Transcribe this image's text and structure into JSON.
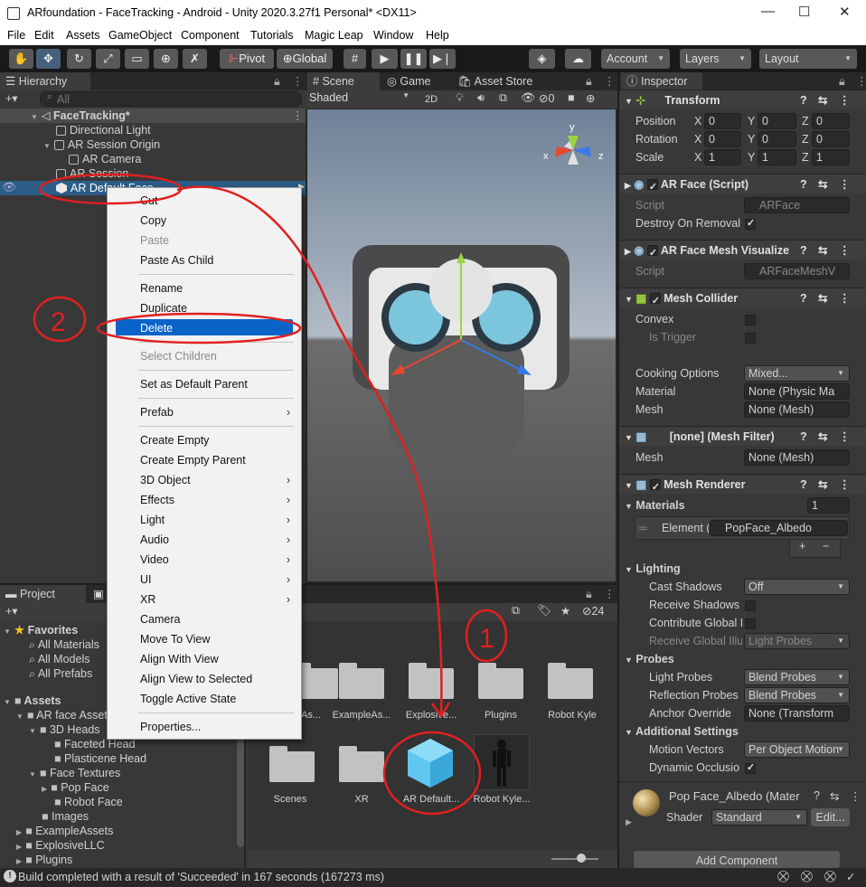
{
  "window": {
    "title": "ARfoundation - FaceTracking - Android - Unity 2020.3.27f1 Personal* <DX11>"
  },
  "menu": [
    "File",
    "Edit",
    "Assets",
    "GameObject",
    "Component",
    "Tutorials",
    "Magic Leap",
    "Window",
    "Help"
  ],
  "toolbar": {
    "pivot": "Pivot",
    "global": "Global",
    "account": "Account",
    "layers": "Layers",
    "layout": "Layout"
  },
  "hierarchy": {
    "tab": "Hierarchy",
    "search_placeholder": "All",
    "scene": "FaceTracking*",
    "items": [
      "Directional Light",
      "AR Session Origin",
      "AR Camera",
      "AR Session",
      "AR Default Face"
    ]
  },
  "scene_view": {
    "tab_scene": "Scene",
    "tab_game": "Game",
    "tab_asset_store": "Asset Store",
    "shading": "Shaded",
    "mode_2d": "2D",
    "gizmo_count": "0",
    "axis_x": "x",
    "axis_y": "y",
    "axis_z": "z"
  },
  "context_menu": {
    "items": [
      "Cut",
      "Copy",
      "Paste",
      "Paste As Child",
      "Rename",
      "Duplicate",
      "Delete",
      "Select Children",
      "Set as Default Parent",
      "Prefab",
      "Create Empty",
      "Create Empty Parent",
      "3D Object",
      "Effects",
      "Light",
      "Audio",
      "Video",
      "UI",
      "XR",
      "Camera",
      "Move To View",
      "Align With View",
      "Align View to Selected",
      "Toggle Active State",
      "Properties..."
    ],
    "highlighted": "Delete"
  },
  "project": {
    "tab": "Project",
    "tab2": "Co",
    "badge": "24",
    "favorites": {
      "label": "Favorites",
      "items": [
        "All Materials",
        "All Models",
        "All Prefabs"
      ]
    },
    "assets": {
      "label": "Assets",
      "items": [
        "AR face Assets",
        "3D Heads",
        "Faceted Head",
        "Plasticene Head",
        "Face Textures",
        "Pop Face",
        "Robot Face",
        "Images",
        "ExampleAssets",
        "ExplosiveLLC",
        "Plugins"
      ]
    },
    "grid_row1": [
      "As...",
      "ExampleAs...",
      "Explosive...",
      "Plugins",
      "Robot Kyle"
    ],
    "grid_row2": [
      "Scenes",
      "XR",
      "AR Default...",
      "Robot Kyle..."
    ]
  },
  "inspector": {
    "tab": "Inspector",
    "transform": {
      "title": "Transform",
      "position_label": "Position",
      "rotation_label": "Rotation",
      "scale_label": "Scale",
      "position": [
        "0",
        "0",
        "0"
      ],
      "rotation": [
        "0",
        "0",
        "0"
      ],
      "scale": [
        "1",
        "1",
        "1"
      ],
      "x": "X",
      "y": "Y",
      "z": "Z"
    },
    "ar_face": {
      "title": "AR Face (Script)",
      "script_label": "Script",
      "script_value": "ARFace",
      "destroy_label": "Destroy On Removal"
    },
    "ar_face_mesh": {
      "title": "AR Face Mesh Visualize",
      "script_label": "Script",
      "script_value": "ARFaceMeshV"
    },
    "mesh_collider": {
      "title": "Mesh Collider",
      "convex": "Convex",
      "is_trigger": "Is Trigger",
      "cooking_label": "Cooking Options",
      "cooking_value": "Mixed...",
      "material_label": "Material",
      "material_value": "None (Physic Ma",
      "mesh_label": "Mesh",
      "mesh_value": "None (Mesh)"
    },
    "mesh_filter": {
      "title": "[none] (Mesh Filter)",
      "mesh_label": "Mesh",
      "mesh_value": "None (Mesh)"
    },
    "mesh_renderer": {
      "title": "Mesh Renderer",
      "materials_label": "Materials",
      "materials_count": "1",
      "element_label": "Element (",
      "element_value": "PopFace_Albedo",
      "lighting": "Lighting",
      "cast_shadows": "Cast Shadows",
      "cast_value": "Off",
      "receive_shadows": "Receive Shadows",
      "contribute_gi": "Contribute Global I",
      "receive_gi": "Receive Global Illu",
      "receive_gi_value": "Light Probes",
      "probes": "Probes",
      "light_probes": "Light Probes",
      "light_probes_value": "Blend Probes",
      "reflection_probes": "Reflection Probes",
      "reflection_value": "Blend Probes",
      "anchor_override": "Anchor Override",
      "anchor_value": "None (Transform",
      "additional": "Additional Settings",
      "motion_vectors": "Motion Vectors",
      "motion_value": "Per Object Motion",
      "dynamic_occlusion": "Dynamic Occlusio"
    },
    "material": {
      "name": "Pop Face_Albedo (Mater",
      "shader_label": "Shader",
      "shader_value": "Standard",
      "edit": "Edit..."
    },
    "add_component": "Add Component"
  },
  "annotations": {
    "one": "1",
    "two": "2"
  },
  "status": "Build completed with a result of 'Succeeded' in 167 seconds (167273 ms)"
}
